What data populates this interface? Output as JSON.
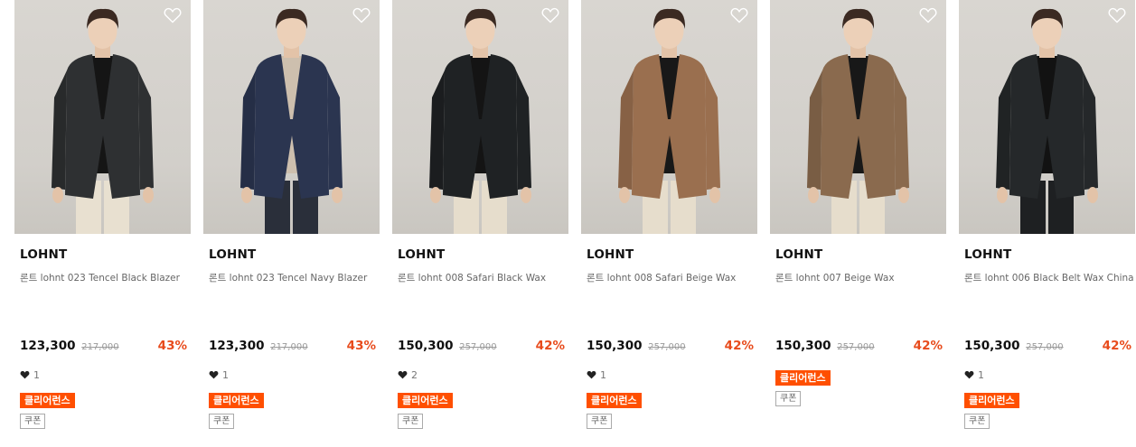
{
  "colors": {
    "accent": "#e84b1c",
    "clearance_badge": "#ff4f00"
  },
  "products": [
    {
      "brand": "LOHNT",
      "name": "론트 lohnt 023 Tencel Black Blazer",
      "price": "123,300",
      "original_price": "217,000",
      "discount": "43%",
      "likes": "1",
      "badge": "클리어런스",
      "coupon": "쿠폰",
      "jacket_color": "#2e3032",
      "inner_color": "#151515",
      "pants_color": "#e8e0d0",
      "show_likes": true
    },
    {
      "brand": "LOHNT",
      "name": "론트 lohnt 023 Tencel Navy Blazer",
      "price": "123,300",
      "original_price": "217,000",
      "discount": "43%",
      "likes": "1",
      "badge": "클리어런스",
      "coupon": "쿠폰",
      "jacket_color": "#2b3550",
      "inner_color": "#cdbfae",
      "pants_color": "#2a2f3a",
      "show_likes": true
    },
    {
      "brand": "LOHNT",
      "name": "론트 lohnt 008 Safari Black Wax",
      "price": "150,300",
      "original_price": "257,000",
      "discount": "42%",
      "likes": "2",
      "badge": "클리어런스",
      "coupon": "쿠폰",
      "jacket_color": "#1f2224",
      "inner_color": "#141414",
      "pants_color": "#e6ddcc",
      "show_likes": true
    },
    {
      "brand": "LOHNT",
      "name": "론트 lohnt 008 Safari Beige Wax",
      "price": "150,300",
      "original_price": "257,000",
      "discount": "42%",
      "likes": "1",
      "badge": "클리어런스",
      "coupon": "쿠폰",
      "jacket_color": "#9a6f4f",
      "inner_color": "#181818",
      "pants_color": "#e6ddcc",
      "show_likes": true
    },
    {
      "brand": "LOHNT",
      "name": "론트 lohnt 007 Beige Wax",
      "price": "150,300",
      "original_price": "257,000",
      "discount": "42%",
      "likes": "",
      "badge": "클리어런스",
      "coupon": "쿠폰",
      "jacket_color": "#8a6a4e",
      "inner_color": "#181818",
      "pants_color": "#e6ddcc",
      "show_likes": false
    },
    {
      "brand": "LOHNT",
      "name": "론트 lohnt 006 Black Belt Wax China",
      "price": "150,300",
      "original_price": "257,000",
      "discount": "42%",
      "likes": "1",
      "badge": "클리어런스",
      "coupon": "쿠폰",
      "jacket_color": "#25282a",
      "inner_color": "#121212",
      "pants_color": "#1e2022",
      "show_likes": true
    }
  ]
}
